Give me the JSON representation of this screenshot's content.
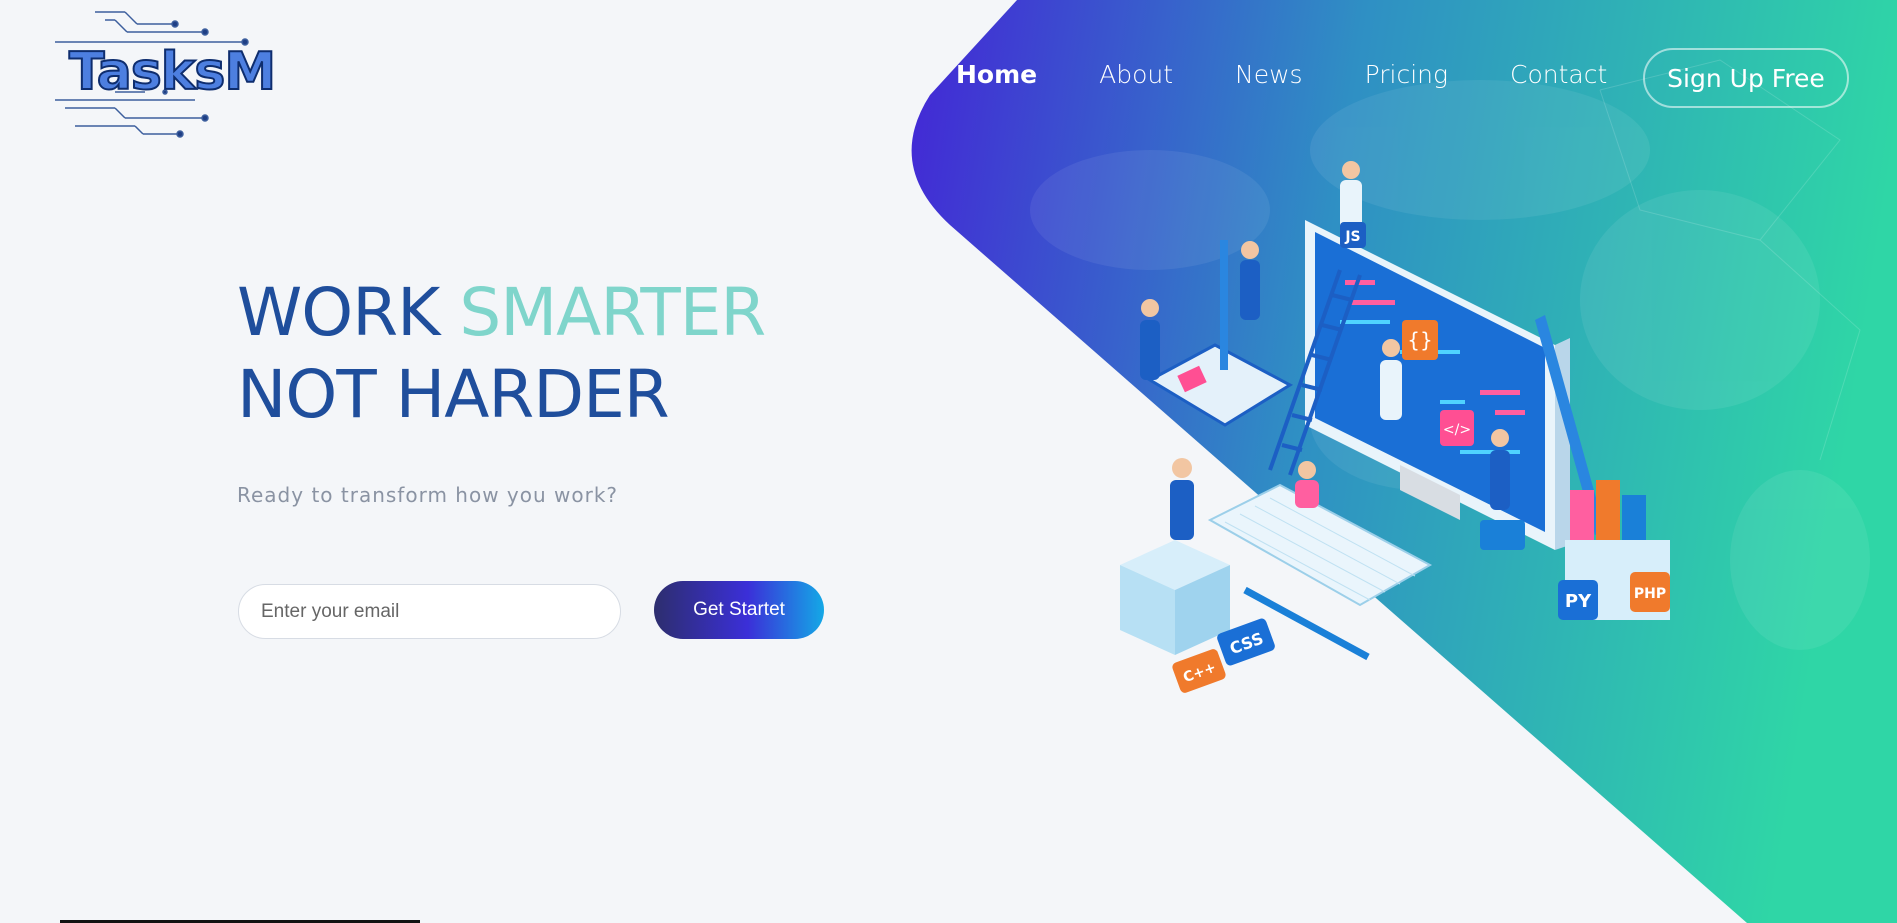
{
  "brand": {
    "logo_text": "TasksM"
  },
  "nav": {
    "items": [
      {
        "label": "Home",
        "active": true
      },
      {
        "label": "About",
        "active": false
      },
      {
        "label": "News",
        "active": false
      },
      {
        "label": "Pricing",
        "active": false
      },
      {
        "label": "Contact",
        "active": false
      }
    ],
    "signup_label": "Sign Up Free"
  },
  "hero": {
    "headline_word1": "WORK",
    "headline_word2": "SMARTER",
    "headline_line2": "NOT HARDER",
    "subtext": "Ready to transform how you work?",
    "email_placeholder": "Enter your email",
    "cta_label": "Get Startet"
  },
  "illustration": {
    "labels": [
      "JS",
      "CSS",
      "C++",
      "PY",
      "PHP"
    ]
  },
  "colors": {
    "gradient_start": "#4326d6",
    "gradient_mid": "#2f8fc4",
    "gradient_end": "#2fd6a6",
    "headline": "#1f4e9c",
    "accent": "#7fd5cb"
  }
}
